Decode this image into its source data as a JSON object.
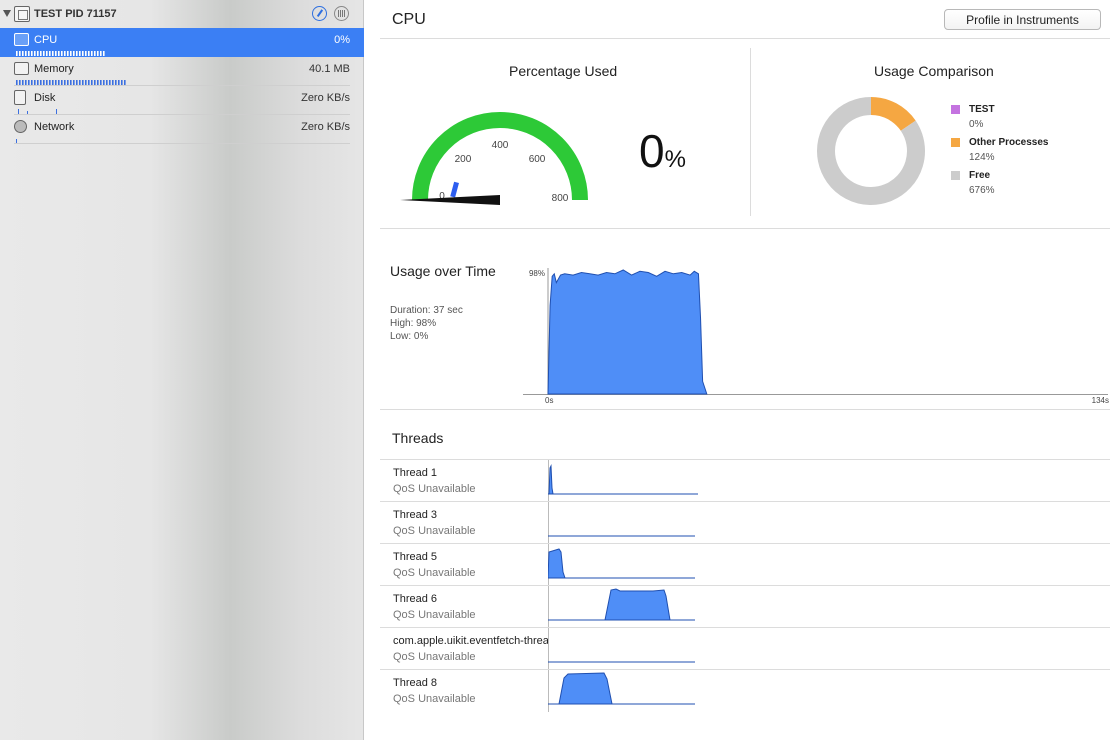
{
  "process": {
    "name": "TEST",
    "pid_label": "PID 71157"
  },
  "navigator": [
    {
      "label": "CPU",
      "value": "0%",
      "selected": true
    },
    {
      "label": "Memory",
      "value": "40.1 MB",
      "selected": false
    },
    {
      "label": "Disk",
      "value": "Zero KB/s",
      "selected": false
    },
    {
      "label": "Network",
      "value": "Zero KB/s",
      "selected": false
    }
  ],
  "header": {
    "title": "CPU",
    "profile_button": "Profile in Instruments"
  },
  "percentage_used": {
    "title": "Percentage Used",
    "value": "0",
    "unit": "%",
    "gauge_ticks": [
      "0",
      "200",
      "400",
      "600",
      "800"
    ],
    "gauge_max": 800,
    "gauge_value": 0
  },
  "usage_comparison": {
    "title": "Usage Comparison",
    "legend": [
      {
        "name": "TEST",
        "value": "0%",
        "color": "#c473e0"
      },
      {
        "name": "Other Processes",
        "value": "124%",
        "color": "#f5a742"
      },
      {
        "name": "Free",
        "value": "676%",
        "color": "#cccccc"
      }
    ]
  },
  "usage_over_time": {
    "title": "Usage over Time",
    "duration": "Duration: 37 sec",
    "high": "High: 98%",
    "low": "Low: 0%",
    "y_max_label": "98%",
    "x_start_label": "0s",
    "x_end_label": "134s"
  },
  "threads": {
    "title": "Threads",
    "items": [
      {
        "name": "Thread 1",
        "qos": "QoS Unavailable"
      },
      {
        "name": "Thread 3",
        "qos": "QoS Unavailable"
      },
      {
        "name": "Thread 5",
        "qos": "QoS Unavailable"
      },
      {
        "name": "Thread 6",
        "qos": "QoS Unavailable"
      },
      {
        "name": "com.apple.uikit.eventfetch-thread",
        "qos": "QoS Unavailable"
      },
      {
        "name": "Thread 8",
        "qos": "QoS Unavailable"
      }
    ]
  },
  "colors": {
    "accent": "#3b7ff4",
    "chart_fill": "#4f8ef7",
    "chart_stroke": "#1f4fb0",
    "gauge_green": "#2dc937"
  },
  "chart_data": [
    {
      "type": "pie",
      "title": "Usage Comparison",
      "categories": [
        "TEST",
        "Other Processes",
        "Free"
      ],
      "values": [
        0,
        124,
        676
      ]
    },
    {
      "type": "area",
      "title": "Usage over Time",
      "xlabel": "",
      "ylabel": "",
      "xlim": [
        0,
        134
      ],
      "ylim": [
        0,
        98
      ],
      "x": [
        0,
        0.5,
        1,
        1.5,
        2,
        3,
        4,
        6,
        8,
        10,
        12,
        14,
        16,
        18,
        20,
        22,
        24,
        26,
        28,
        30,
        32,
        34,
        35,
        36,
        36.5,
        37,
        38
      ],
      "y": [
        0,
        70,
        93,
        95,
        88,
        94,
        95,
        94,
        96,
        95,
        94,
        96,
        95,
        98,
        94,
        97,
        96,
        93,
        97,
        95,
        96,
        94,
        97,
        95,
        60,
        10,
        0
      ]
    }
  ]
}
